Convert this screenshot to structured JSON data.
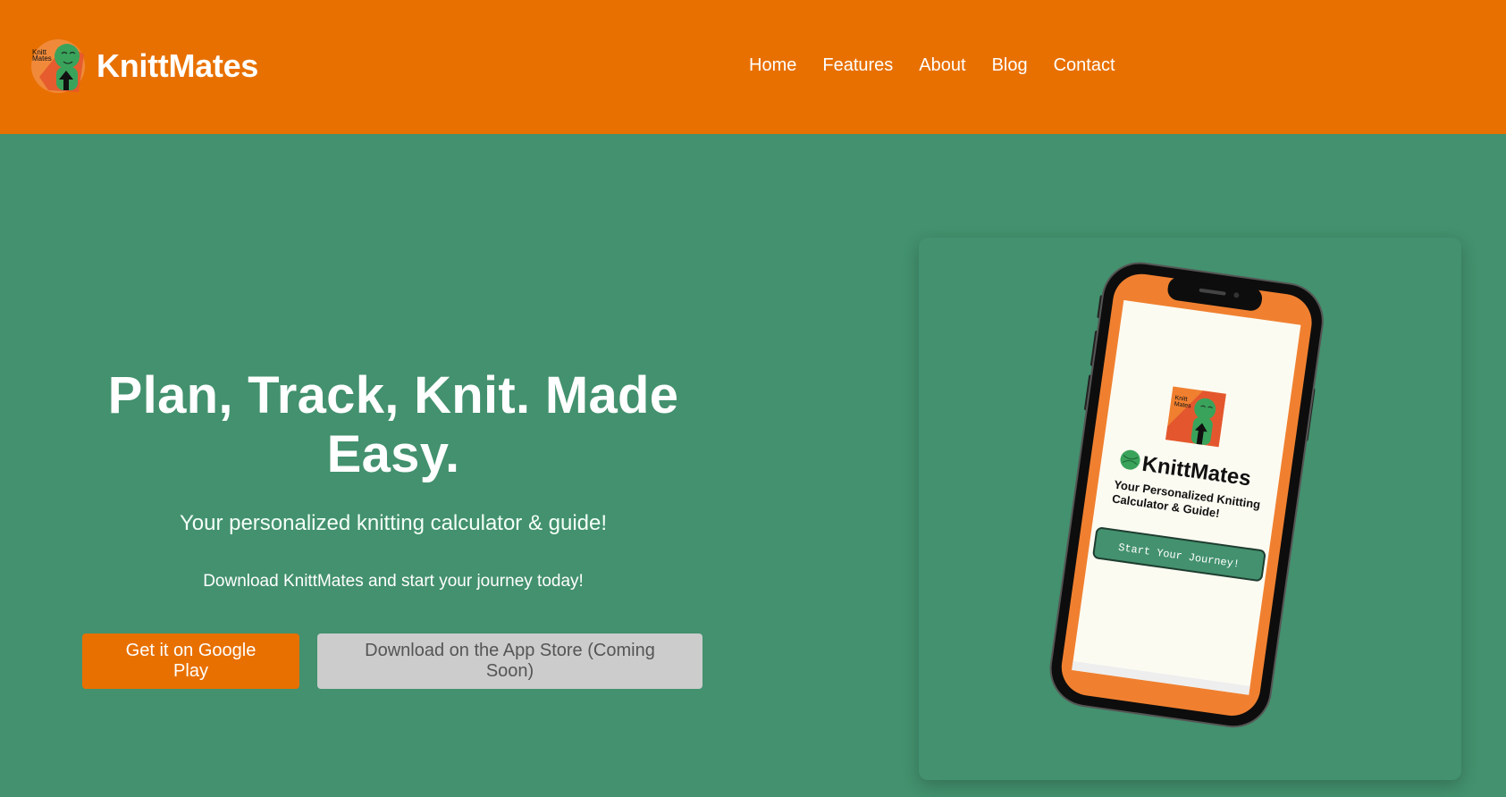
{
  "header": {
    "brand": "KnittMates",
    "logo_text_line1": "Knitt",
    "logo_text_line2": "Mates",
    "nav": [
      "Home",
      "Features",
      "About",
      "Blog",
      "Contact"
    ]
  },
  "hero": {
    "title": "Plan, Track, Knit. Made Easy.",
    "subtitle": "Your personalized knitting calculator & guide!",
    "cta_text": "Download KnittMates and start your journey today!",
    "google_play_label": "Get it on Google Play",
    "app_store_label": "Download on the App Store (Coming Soon)"
  },
  "phone_screen": {
    "logo_text_line1": "Knitt",
    "logo_text_line2": "Mates",
    "app_name": "KnittMates",
    "tagline_line1": "Your Personalized Knitting",
    "tagline_line2": "Calculator & Guide!",
    "start_button": "Start Your Journey!"
  },
  "colors": {
    "header_bg": "#e87000",
    "page_bg": "#43916e",
    "accent_orange": "#e87000",
    "phone_orange": "#f08030",
    "button_disabled": "#cccccc"
  },
  "icons": [
    "knittmates-logo-icon",
    "phone-mockup"
  ]
}
